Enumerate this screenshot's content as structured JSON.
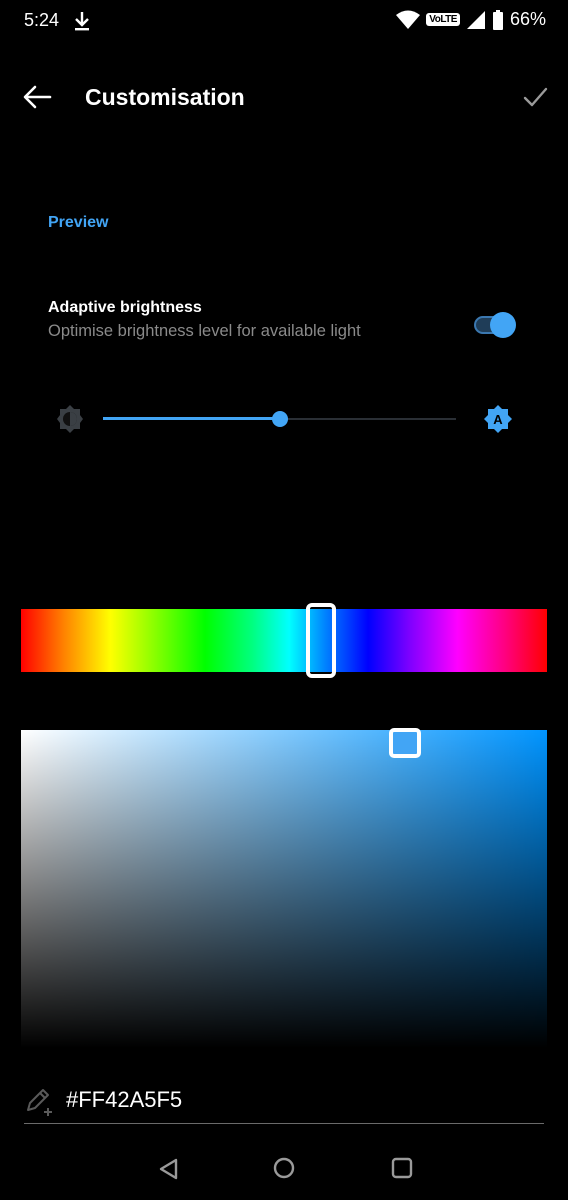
{
  "status_bar": {
    "time": "5:24",
    "volte": "VoLTE",
    "battery": "66%",
    "icons": [
      "download-icon",
      "wifi-icon",
      "signal-icon",
      "battery-icon"
    ]
  },
  "app_bar": {
    "title": "Customisation",
    "back_icon": "arrow-left-icon",
    "done_icon": "checkmark-icon"
  },
  "preview": {
    "label": "Preview"
  },
  "adaptive_brightness": {
    "title": "Adaptive brightness",
    "subtitle": "Optimise brightness level for available light",
    "enabled": true
  },
  "brightness_slider": {
    "value": 0.5,
    "low_icon": "brightness-low-icon",
    "auto_icon": "brightness-auto-icon"
  },
  "color_picker": {
    "hue": 0.57,
    "saturation": 0.73,
    "value": 0.96,
    "hex_value": "#FF42A5F5",
    "edit_icon": "edit-color-icon"
  },
  "colors": {
    "accent": "#42A5F5",
    "background": "#000000",
    "secondary_text": "#8a8a8a"
  },
  "nav_bar": {
    "icons": [
      "nav-back-icon",
      "nav-home-icon",
      "nav-recents-icon"
    ]
  }
}
